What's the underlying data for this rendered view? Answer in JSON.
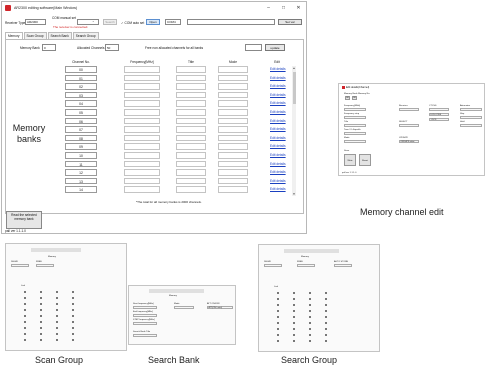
{
  "main_window": {
    "title": "AR2300 editing software(Main Window)",
    "controls": {
      "minimize": "–",
      "maximize": "□",
      "close": "✕"
    },
    "receiver_type_label": "Receiver Type",
    "receiver_type_value": "AR2300",
    "com_manual_label": "COM manual set",
    "com_value": "",
    "search_btn": "Search",
    "com_auto_label": "✓ COM auto set",
    "open_btn": "Open",
    "com4": "COM4",
    "set_var_btn": "Set var",
    "warning": "The receiver is connected.",
    "tabs": [
      "Memory",
      "Scan Group",
      "Search Bank",
      "Search Group"
    ],
    "memory_bank_label": "Memory Bank",
    "memory_bank_value": "0",
    "allocated_label": "Allocated Channels",
    "allocated_value": "50",
    "free_label": "Free non allocated channels for all banks",
    "free_value": "",
    "update_btn": "update",
    "headers": {
      "ch": "Channel No.",
      "freq": "Frequency[MHz]",
      "title": "Title",
      "mode": "Mode",
      "edit": "Edit"
    },
    "channels": [
      "00",
      "01",
      "02",
      "03",
      "04",
      "05",
      "06",
      "07",
      "08",
      "09",
      "10",
      "11",
      "12",
      "13",
      "14"
    ],
    "edit_link": "Edit details",
    "total_note": "*The total for all memory banks is 2000 channels.",
    "read_btn": "Read the selected memory bank",
    "version": "pall ver 1.1.1.0"
  },
  "mce": {
    "title": "Edit details(Channel)",
    "bank_label": "Memory Bank  Memory No.",
    "bank_vals": [
      "00",
      "00"
    ],
    "freq_label": "Frequency[MHz]",
    "freq_step_label": "Step",
    "step_label": "Frequency step",
    "title_label": "Title",
    "tone_label": "Tone / D-Squelch",
    "mode_label": "Mode",
    "receiver_label": "Receiver",
    "ctcss_label": "CTCSS",
    "dcs_label": "DCS CODE",
    "dcs_value": "DCS CODE",
    "vsc_label": "VSC",
    "vsc_value": "1 DCS",
    "select_label": "SELECT",
    "attn_label": "Attenuator",
    "skip_label": "Skip",
    "hold_label": "Hold",
    "filter_label": "Filter",
    "lpf_label": "LPF/HPF",
    "lpf_value": "OFF/HPF value",
    "write_btn": "Write",
    "store_label": "Store",
    "reset_btn": "Reset",
    "delete_btn": "Delete",
    "phone_label": "Phone filter",
    "ver": "pall ver 1.1.1.0"
  },
  "scan_group": {
    "title": "Scan Group",
    "memory_lbl": "Memory",
    "delay_lbl": "DELAY",
    "free_lbl": "FREE",
    "link_lbl": "Link"
  },
  "search_bank": {
    "title": "Search Bank",
    "memory_lbl": "Memory",
    "fields": [
      "Start frequency[MHz]",
      "End frequency[MHz]",
      "STEP frequency[MHz]"
    ],
    "mode_lbl": "Mode",
    "att_lbl": "ATT ON/OFF",
    "att_val": "ATT(ON / auto)",
    "search_title_lbl": "Search Bank Title"
  },
  "search_group": {
    "title": "Search Group",
    "memory_lbl": "Memory",
    "delay_lbl": "DELAY",
    "free_lbl": "FREE",
    "auto_lbl": "AUTO STORE",
    "link_lbl": "Link"
  },
  "labels": {
    "memory_banks": "Memory banks",
    "memory_channel_edit": "Memory channel edit",
    "scan_group": "Scan Group",
    "search_bank": "Search Bank",
    "search_group": "Search Group"
  },
  "colors": {
    "accent": "#d1252b",
    "link": "#1a40c0"
  }
}
